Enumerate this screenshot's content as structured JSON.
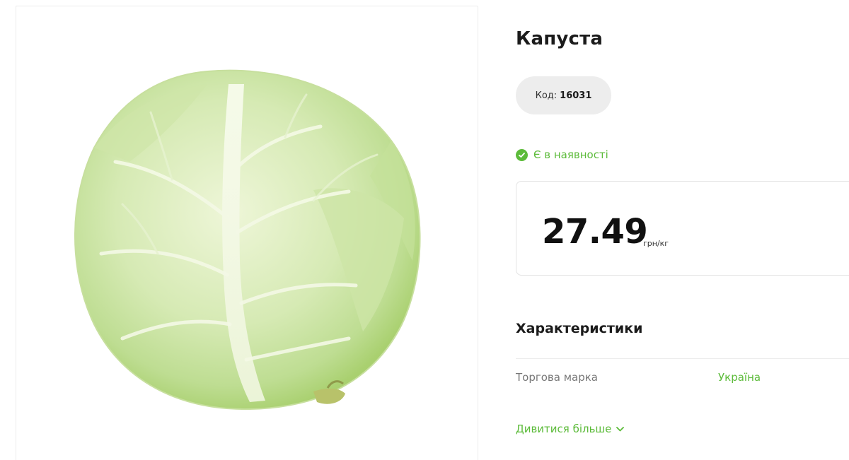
{
  "product": {
    "title": "Капуста",
    "code_label": "Код:",
    "code_value": "16031",
    "stock_status": "Є в наявності",
    "price": "27.49",
    "unit": "грн/кг",
    "image_name": "cabbage-image"
  },
  "characteristics": {
    "heading": "Характеристики",
    "rows": [
      {
        "label": "Торгова марка",
        "value": "Україна"
      }
    ],
    "more_link": "Дивитися більше"
  },
  "colors": {
    "accent_green": "#5cbb3a",
    "pill_bg": "#ededed"
  },
  "icons": {
    "stock": "check-circle-icon",
    "more": "chevron-down-icon"
  }
}
